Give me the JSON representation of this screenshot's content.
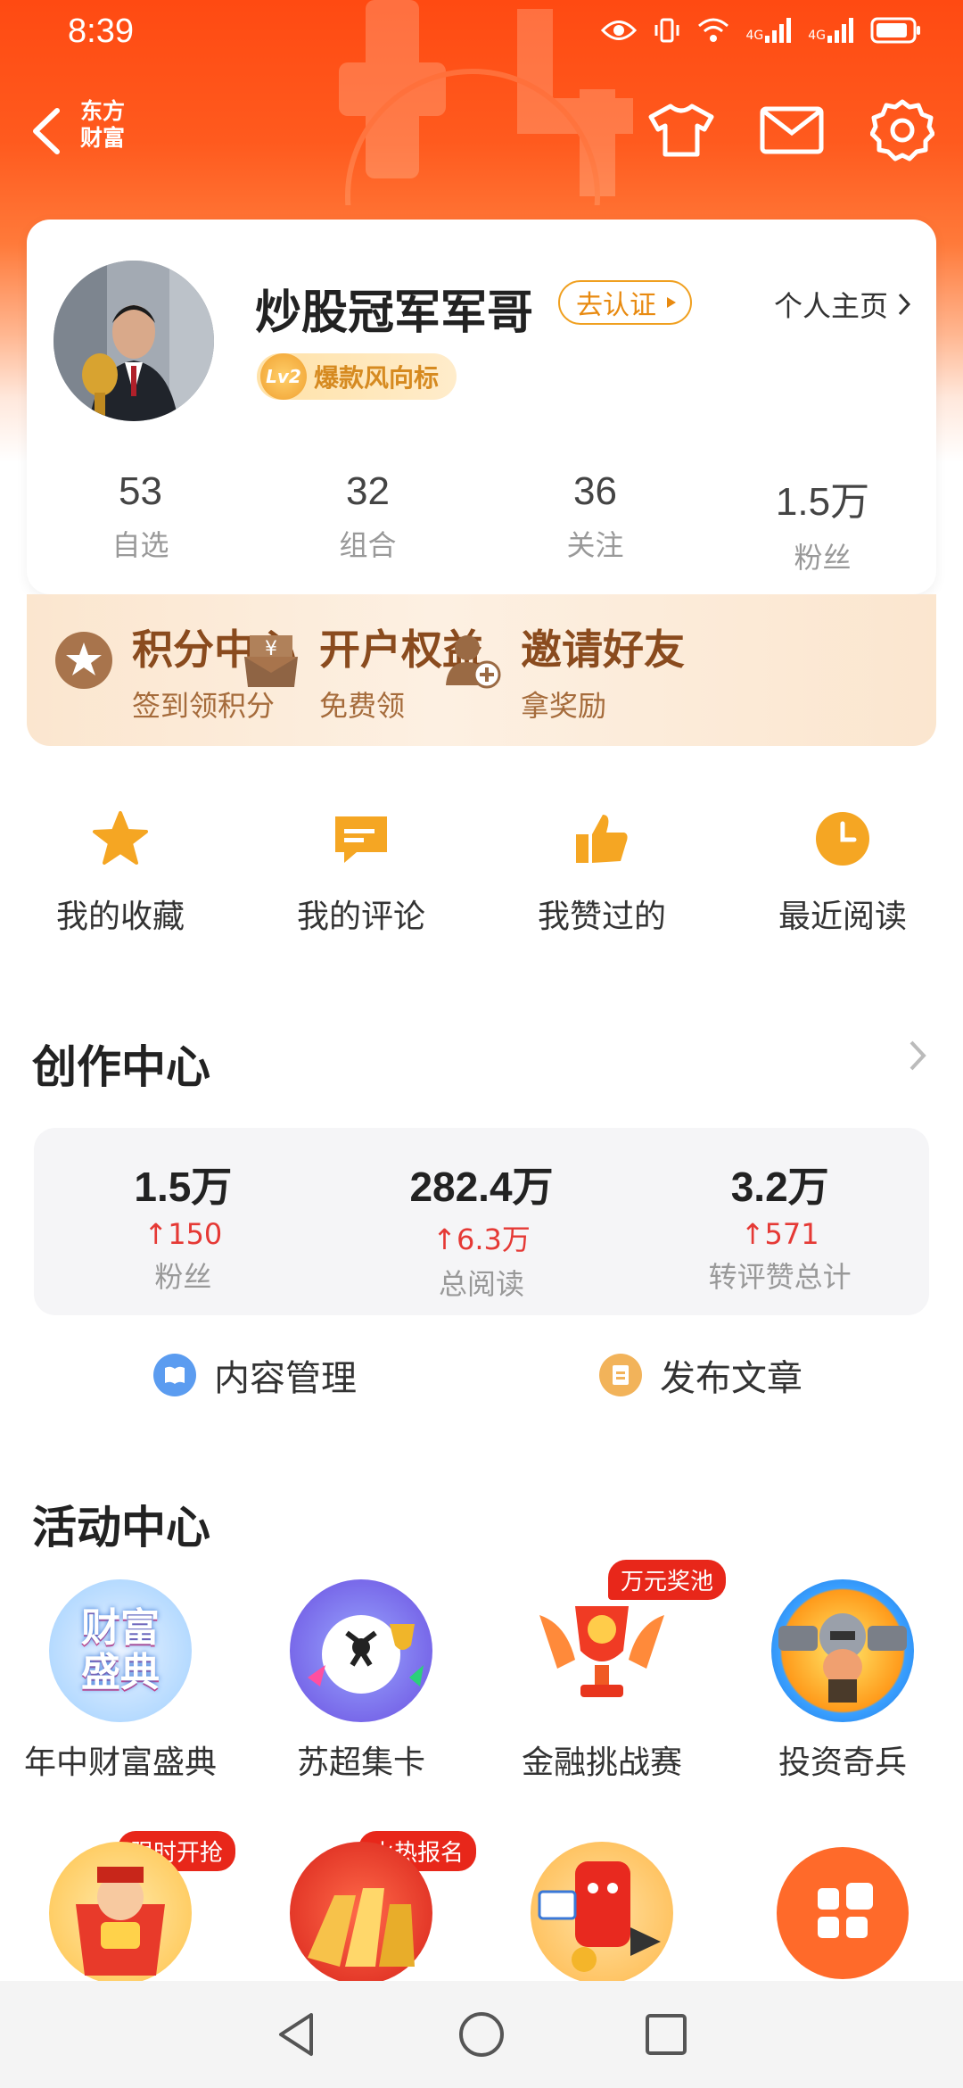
{
  "status_bar": {
    "time": "8:39",
    "network_1": "4G",
    "network_2": "4G"
  },
  "header": {
    "logo_line1": "东方",
    "logo_line2": "财富"
  },
  "profile": {
    "name": "炒股冠军军哥",
    "verify_label": "去认证",
    "homepage_label": "个人主页",
    "level_code": "Lv2",
    "level_title": "爆款风向标",
    "stats": [
      {
        "value": "53",
        "label": "自选"
      },
      {
        "value": "32",
        "label": "组合"
      },
      {
        "value": "36",
        "label": "关注"
      },
      {
        "value": "1.5万",
        "label": "粉丝"
      }
    ]
  },
  "promo": [
    {
      "title": "积分中心",
      "sub": "签到领积分",
      "icon": "star-coin-icon"
    },
    {
      "title": "开户权益",
      "sub": "免费领",
      "icon": "yuan-box-icon"
    },
    {
      "title": "邀请好友",
      "sub": "拿奖励",
      "icon": "add-user-icon"
    }
  ],
  "quick": [
    {
      "label": "我的收藏",
      "icon": "star-icon"
    },
    {
      "label": "我的评论",
      "icon": "comment-icon"
    },
    {
      "label": "我赞过的",
      "icon": "thumbs-up-icon"
    },
    {
      "label": "最近阅读",
      "icon": "clock-icon"
    }
  ],
  "creation": {
    "title": "创作中心",
    "stats": [
      {
        "value": "1.5万",
        "delta": "150",
        "label": "粉丝"
      },
      {
        "value": "282.4万",
        "delta": "6.3万",
        "label": "总阅读"
      },
      {
        "value": "3.2万",
        "delta": "571",
        "label": "转评赞总计"
      }
    ],
    "actions": [
      {
        "label": "内容管理",
        "icon": "book-icon"
      },
      {
        "label": "发布文章",
        "icon": "document-icon"
      }
    ]
  },
  "activity": {
    "title": "活动中心",
    "row1": [
      {
        "label": "年中财富盛典",
        "art_text": "财富盛典",
        "badge": ""
      },
      {
        "label": "苏超集卡",
        "art_text": "",
        "badge": ""
      },
      {
        "label": "金融挑战赛",
        "art_text": "",
        "badge": "万元奖池"
      },
      {
        "label": "投资奇兵",
        "art_text": "",
        "badge": ""
      }
    ],
    "row2": [
      {
        "badge": "限时开抢"
      },
      {
        "badge": "火热报名"
      },
      {
        "badge": ""
      },
      {
        "badge": ""
      }
    ]
  },
  "colors": {
    "brand": "#ff5a1e",
    "up": "#e53935",
    "promo_text": "#8a4b1e"
  }
}
